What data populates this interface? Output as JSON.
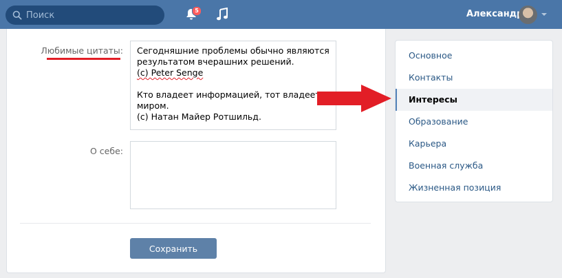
{
  "header": {
    "search_placeholder": "Поиск",
    "notifications_count": "5",
    "user_name": "Александр"
  },
  "form": {
    "quotes_label": "Любимые цитаты:",
    "quotes_lines": [
      "Сегодняшние проблемы обычно являются",
      "результатом вчерашних решений.",
      "(с) Peter Senge",
      "",
      "Кто владеет информацией, тот владеет",
      "миром.",
      "(с) Натан Майер Ротшильд."
    ],
    "about_label": "О себе:",
    "about_value": "",
    "save_label": "Сохранить"
  },
  "menu": {
    "items": [
      {
        "label": "Основное"
      },
      {
        "label": "Контакты"
      },
      {
        "label": "Интересы"
      },
      {
        "label": "Образование"
      },
      {
        "label": "Карьера"
      },
      {
        "label": "Военная служба"
      },
      {
        "label": "Жизненная позиция"
      }
    ],
    "active_index": 2
  },
  "colors": {
    "header_bg": "#4a76a8",
    "link": "#2a5885",
    "highlight_red": "#e21e26",
    "button_bg": "#5e81a8"
  }
}
